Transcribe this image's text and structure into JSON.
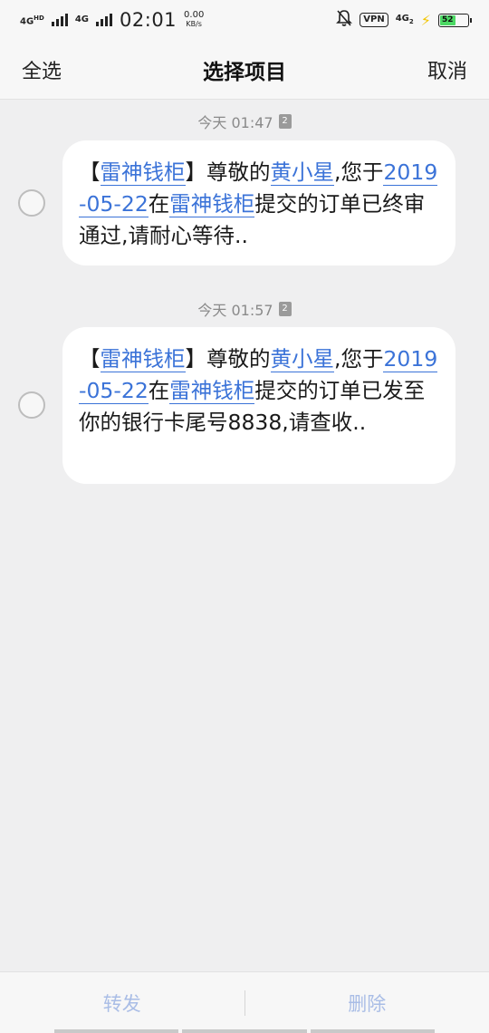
{
  "status_bar": {
    "net1": "4G",
    "net1_sup": "HD",
    "net2": "4G",
    "time": "02:01",
    "speed_value": "0.00",
    "speed_unit": "KB/s",
    "mute_icon": "bell-off-icon",
    "vpn": "VPN",
    "net3": "4G",
    "net3_sub": "2",
    "charging_icon": "lightning-icon",
    "battery": "52"
  },
  "header": {
    "select_all": "全选",
    "title": "选择项目",
    "cancel": "取消"
  },
  "messages": [
    {
      "timestamp": "今天 01:47",
      "sim": "2",
      "parts": {
        "p1": "【",
        "l1": "雷神钱柜",
        "p2": "】尊敬的",
        "l2": "黄小星",
        "p3": ",您于",
        "l3": "2019-05-22",
        "p4": "在",
        "l4": "雷神钱柜",
        "p5": "提交的订单已终审通过,请耐心等待.."
      }
    },
    {
      "timestamp": "今天 01:57",
      "sim": "2",
      "parts": {
        "p1": "【",
        "l1": "雷神钱柜",
        "p2": "】尊敬的",
        "l2": "黄小星",
        "p3": ",您于",
        "l3": "2019-05-22",
        "p4": "在",
        "l4": "雷神钱柜",
        "p5": "提交的订单已发至你的银行卡尾号8838,请查收.."
      }
    }
  ],
  "bottom_bar": {
    "forward": "转发",
    "delete": "删除"
  },
  "colors": {
    "link": "#3b73d8",
    "disabled_action": "#a9bde6",
    "background": "#efeff0"
  }
}
